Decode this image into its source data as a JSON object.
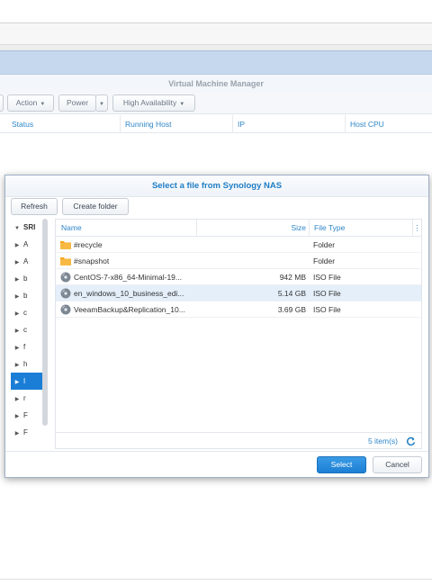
{
  "vmm": {
    "title": "Virtual Machine Manager",
    "toolbar": {
      "action_label": "Action",
      "power_label": "Power",
      "ha_label": "High Availability"
    },
    "columns": [
      "Status",
      "Running Host",
      "IP",
      "Host CPU"
    ]
  },
  "dialog": {
    "title": "Select a file from Synology NAS",
    "refresh_label": "Refresh",
    "create_folder_label": "Create folder",
    "tree_root_label": "SRI",
    "tree_items": [
      "A",
      "A",
      "b",
      "b",
      "c",
      "c",
      "f",
      "h",
      "I",
      "r",
      "F",
      "F"
    ],
    "columns": {
      "name": "Name",
      "size": "Size",
      "type": "File Type"
    },
    "files": [
      {
        "name": "#recycle",
        "size": "",
        "type": "Folder",
        "icon": "folder-icon"
      },
      {
        "name": "#snapshot",
        "size": "",
        "type": "Folder",
        "icon": "folder-icon"
      },
      {
        "name": "CentOS-7-x86_64-Minimal-19...",
        "size": "942 MB",
        "type": "ISO File",
        "icon": "disc-icon"
      },
      {
        "name": "en_windows_10_business_edi...",
        "size": "5.14 GB",
        "type": "ISO File",
        "icon": "disc-icon"
      },
      {
        "name": "VeeamBackup&Replication_10...",
        "size": "3.69 GB",
        "type": "ISO File",
        "icon": "disc-icon"
      }
    ],
    "item_count": "5 item(s)",
    "select_label": "Select",
    "cancel_label": "Cancel"
  },
  "colors": {
    "accent": "#1f7dc4",
    "selected_row": "#e4effa",
    "tree_selected": "#1b7ed6",
    "folder": "#f5a623"
  }
}
